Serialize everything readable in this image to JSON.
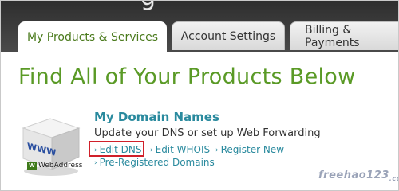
{
  "tabs": [
    {
      "label": "My Products & Services",
      "active": true
    },
    {
      "label": "Account Settings",
      "active": false
    },
    {
      "label": "Billing & Payments",
      "active": false
    }
  ],
  "page_title": "Find All of Your Products Below",
  "product": {
    "title": "My Domain Names",
    "description": "Update your DNS or set up Web Forwarding",
    "links": {
      "edit_dns": "Edit DNS",
      "edit_whois": "Edit WHOIS",
      "register_new": "Register New",
      "pre_registered": "Pre-Registered Domains"
    },
    "logo_text": "WWW",
    "brand": {
      "mark": "W",
      "name": "WebAddress"
    }
  },
  "watermark": {
    "main": "freehao123",
    "suffix": ".com"
  },
  "colors": {
    "accent_green": "#5a9a26",
    "link_teal": "#2a8a9e",
    "highlight_red": "#d0202a"
  }
}
